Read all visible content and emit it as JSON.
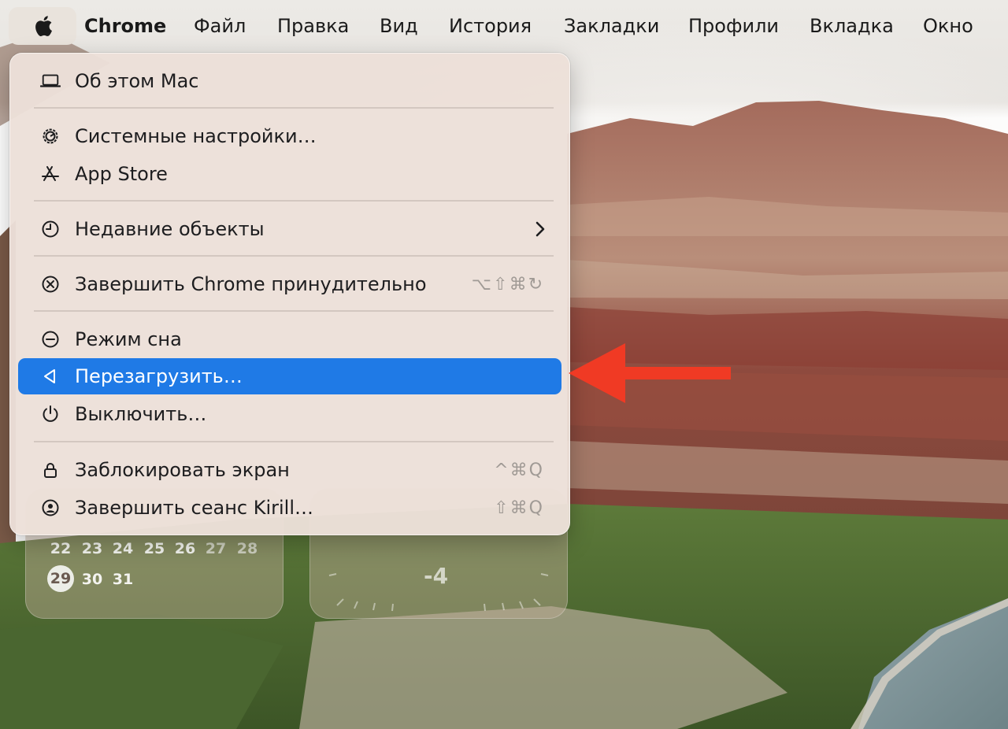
{
  "menubar": {
    "apple_icon": "apple-logo-icon",
    "app_name": "Chrome",
    "items": [
      "Файл",
      "Правка",
      "Вид",
      "История",
      "Закладки",
      "Профили",
      "Вкладка",
      "Окно"
    ]
  },
  "apple_menu": {
    "items": [
      {
        "id": "about",
        "icon": "laptop-icon",
        "label": "Об этом Mac"
      },
      {
        "id": "system-settings",
        "icon": "gear-icon",
        "label": "Системные настройки…"
      },
      {
        "id": "app-store",
        "icon": "app-store-icon",
        "label": "App Store"
      },
      {
        "id": "recent-items",
        "icon": "clock-icon",
        "label": "Недавние объекты",
        "has_submenu": true
      },
      {
        "id": "force-quit",
        "icon": "force-quit-icon",
        "label": "Завершить Chrome принудительно",
        "shortcut": "⌥⇧⌘↻"
      },
      {
        "id": "sleep",
        "icon": "sleep-icon",
        "label": "Режим сна"
      },
      {
        "id": "restart",
        "icon": "restart-icon",
        "label": "Перезагрузить…",
        "selected": true
      },
      {
        "id": "shutdown",
        "icon": "power-icon",
        "label": "Выключить…"
      },
      {
        "id": "lock-screen",
        "icon": "lock-icon",
        "label": "Заблокировать экран",
        "shortcut": "^⌘Q"
      },
      {
        "id": "log-out",
        "icon": "user-icon",
        "label": "Завершить сеанс Kirill…",
        "shortcut": "⇧⌘Q"
      }
    ]
  },
  "calendar_widget": {
    "week_row": [
      "22",
      "23",
      "24",
      "25",
      "26",
      "27",
      "28"
    ],
    "last_row": [
      "29",
      "30",
      "31"
    ],
    "today": "29"
  },
  "weather_widget": {
    "value": "-4"
  },
  "colors": {
    "selection": "#1f7ae6",
    "annotation_arrow": "#f03a24"
  }
}
